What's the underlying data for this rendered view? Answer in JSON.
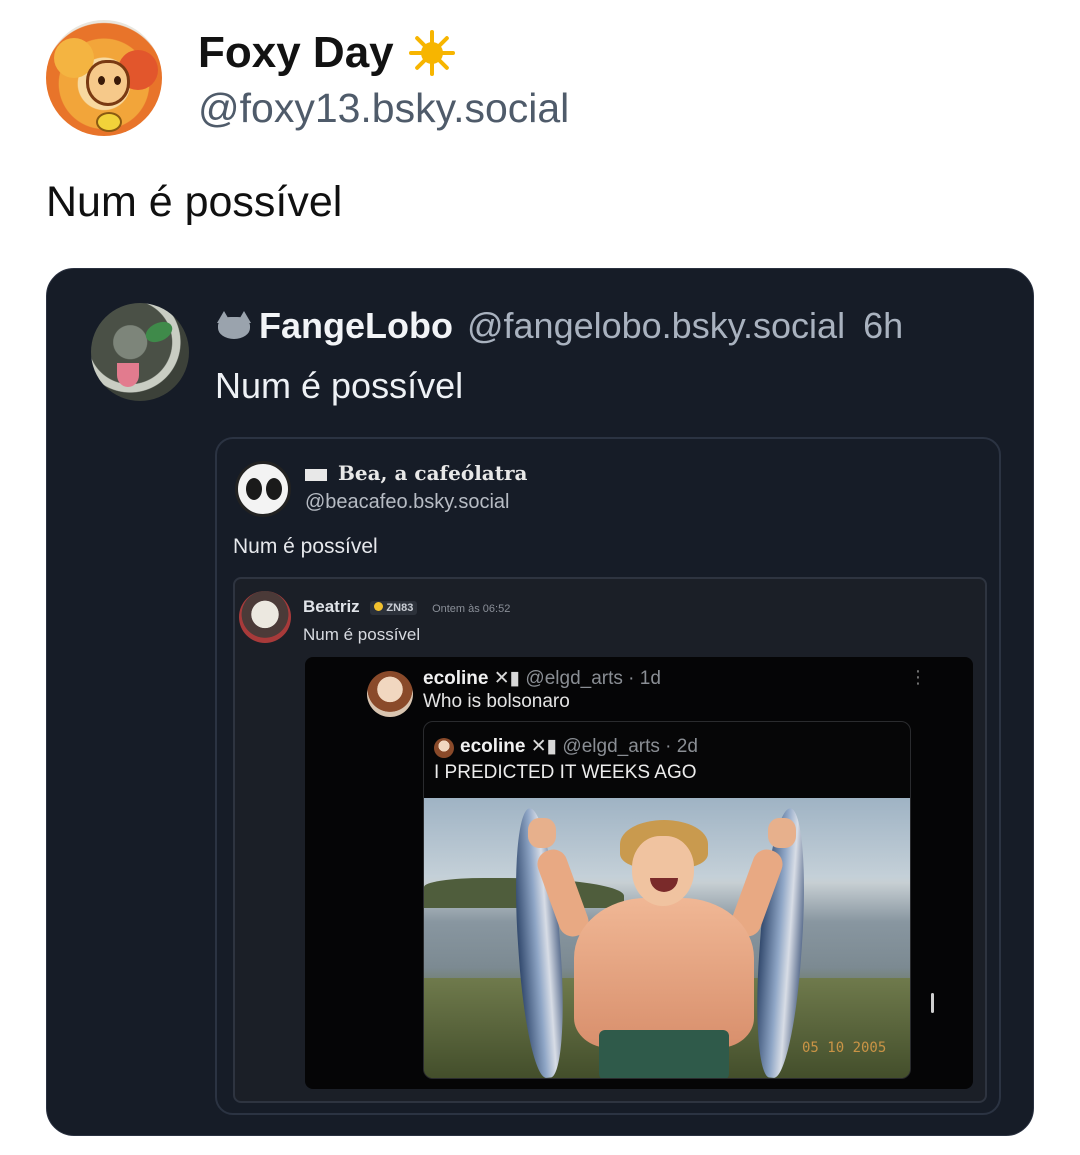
{
  "post": {
    "display_name": "Foxy Day",
    "handle": "@foxy13.bsky.social",
    "text": "Num é possível",
    "status_icon": "sun-icon"
  },
  "quote1": {
    "display_name": "FangeLobo",
    "handle": "@fangelobo.bsky.social",
    "time": "6h",
    "text": "Num é possível",
    "name_icon": "wolf-icon"
  },
  "quote2": {
    "display_name": "‿⚥Bea, a cafeólatra",
    "display_name_text": "Bea, a cafeólatra",
    "handle": "@beacafeo.bsky.social",
    "text": "Num é possível"
  },
  "quote3": {
    "display_name": "Beatriz",
    "badge": "ZN83",
    "time": "Ontem às 06:52",
    "text": "Num é possível"
  },
  "screenshot": {
    "author": "ecoline",
    "handle_time": "@elgd_arts · 1d",
    "text": "Who is bolsonaro",
    "quoted_author": "ecoline",
    "quoted_handle_time": "@elgd_arts · 2d",
    "quoted_text": "I PREDICTED IT WEEKS AGO",
    "image_date_stamp": "05 10 2005"
  },
  "colors": {
    "card_bg": "#161c27",
    "text_primary": "#121212",
    "handle_gray": "#4f5b6a"
  }
}
